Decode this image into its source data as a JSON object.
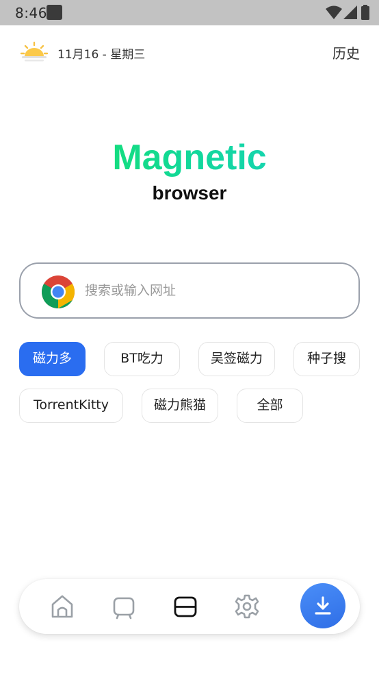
{
  "status_bar": {
    "time": "8:46"
  },
  "header": {
    "date": "11月16 - 星期三",
    "history_label": "历史"
  },
  "logo": {
    "title": "Magnetic",
    "subtitle": "browser"
  },
  "search": {
    "placeholder": "搜索或输入网址",
    "value": ""
  },
  "chips": [
    {
      "label": "磁力多",
      "active": true
    },
    {
      "label": "BT吃力",
      "active": false
    },
    {
      "label": "吴签磁力",
      "active": false
    },
    {
      "label": "种子搜",
      "active": false
    },
    {
      "label": "TorrentKitty",
      "active": false
    },
    {
      "label": "磁力熊猫",
      "active": false
    },
    {
      "label": "全部",
      "active": false
    }
  ],
  "bottom_nav": {
    "items": [
      {
        "icon": "home-icon"
      },
      {
        "icon": "tv-icon"
      },
      {
        "icon": "tabs-icon",
        "active": true
      },
      {
        "icon": "gear-icon"
      },
      {
        "icon": "download-icon"
      }
    ]
  },
  "colors": {
    "accent": "#2a6df0",
    "logo_gradient_start": "#17e35a",
    "logo_gradient_end": "#1ad0c8",
    "status_bar": "#c2c2c2"
  }
}
